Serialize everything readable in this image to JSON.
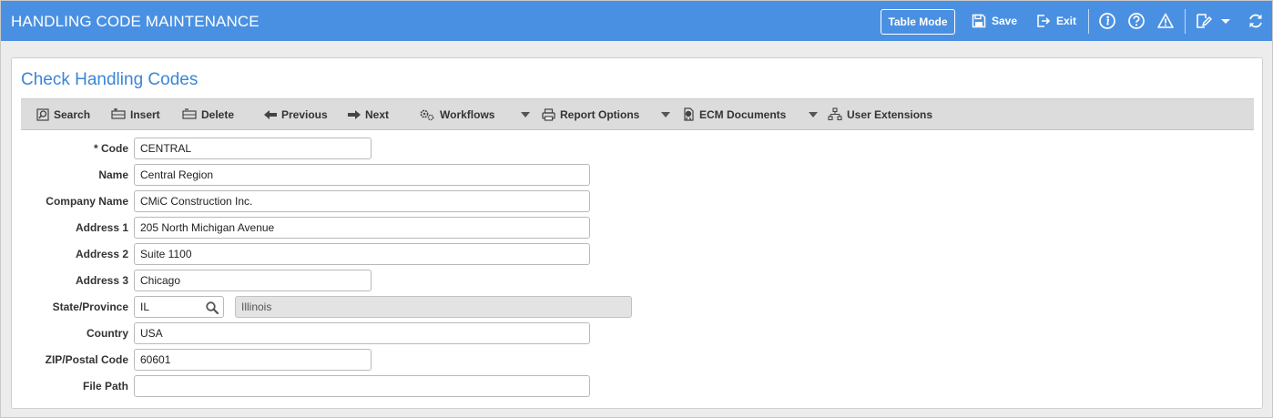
{
  "header": {
    "title": "HANDLING CODE MAINTENANCE",
    "table_mode_label": "Table Mode",
    "save_label": "Save",
    "exit_label": "Exit"
  },
  "page": {
    "title": "Check Handling Codes"
  },
  "toolbar": {
    "search": "Search",
    "insert": "Insert",
    "delete": "Delete",
    "previous": "Previous",
    "next": "Next",
    "workflows": "Workflows",
    "report_options": "Report Options",
    "ecm_documents": "ECM Documents",
    "user_extensions": "User Extensions"
  },
  "form": {
    "code": {
      "label": "* Code",
      "value": "CENTRAL"
    },
    "name": {
      "label": "Name",
      "value": "Central Region"
    },
    "company_name": {
      "label": "Company Name",
      "value": "CMiC Construction Inc."
    },
    "address1": {
      "label": "Address 1",
      "value": "205 North Michigan Avenue"
    },
    "address2": {
      "label": "Address 2",
      "value": "Suite 1100"
    },
    "address3": {
      "label": "Address 3",
      "value": "Chicago"
    },
    "state": {
      "label": "State/Province",
      "value": "IL",
      "description": "Illinois"
    },
    "country": {
      "label": "Country",
      "value": "USA"
    },
    "zip": {
      "label": "ZIP/Postal Code",
      "value": "60601"
    },
    "file_path": {
      "label": "File Path",
      "value": ""
    }
  },
  "colors": {
    "header_bg": "#4a90e2",
    "title_blue": "#3b86d6",
    "toolbar_bg": "#dcdcdc"
  }
}
